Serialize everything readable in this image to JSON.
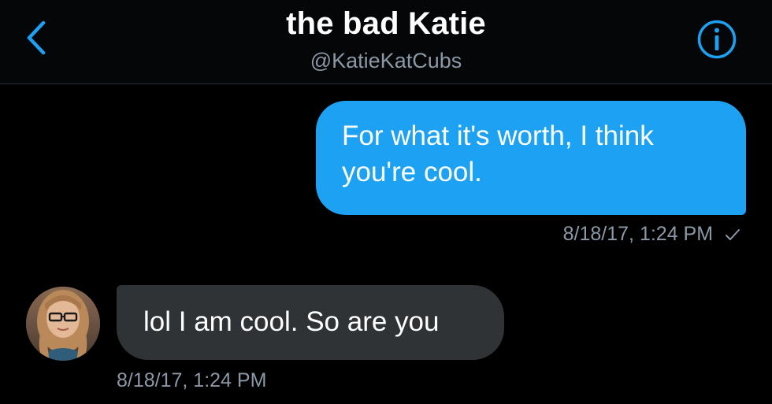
{
  "header": {
    "back_icon": "chevron-left-icon",
    "title": "the bad Katie",
    "handle": "@KatieKatCubs",
    "info_icon": "info-icon"
  },
  "messages": [
    {
      "direction": "outgoing",
      "text": "For what it's worth, I think you're cool.",
      "timestamp": "8/18/17, 1:24 PM",
      "status_icon": "checkmark-icon"
    },
    {
      "direction": "incoming",
      "text": "lol I am cool. So are you",
      "timestamp": "8/18/17, 1:24 PM",
      "avatar_icon": "user-avatar"
    }
  ],
  "colors": {
    "accent": "#1da1f2",
    "background": "#000000",
    "incoming_bubble": "#2f3336",
    "secondary_text": "#8b98a5"
  }
}
